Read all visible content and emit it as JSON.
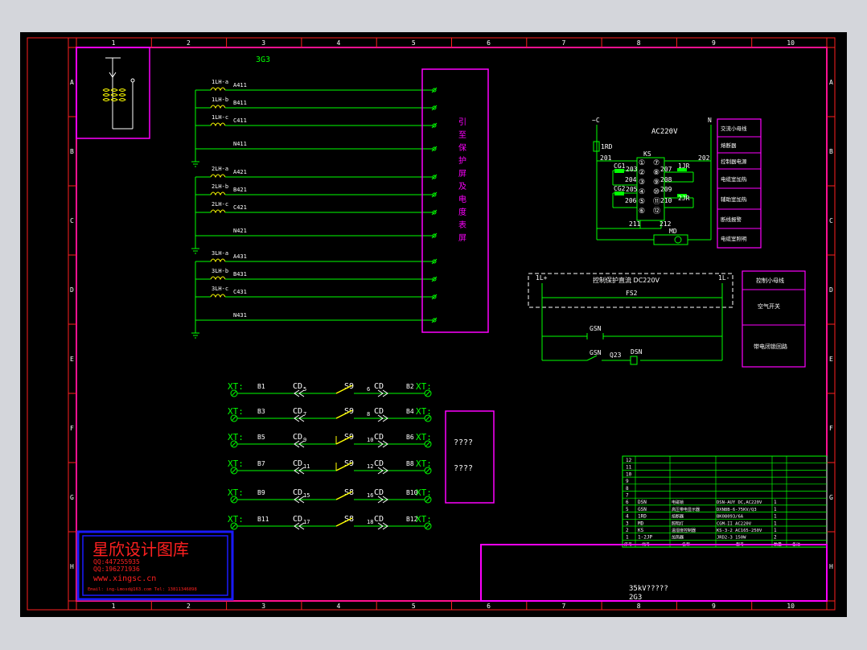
{
  "colors": {
    "background": "#000000",
    "outer_frame": "#ff2020",
    "inner_frame": "#ff00ff",
    "wire": "#00ff00",
    "text": "#ffffff",
    "label": "#00ff00",
    "yellow": "#ffff00",
    "logo_red": "#ff2020",
    "logo_blue": "#1a1aff",
    "dashed": "#ffffff"
  },
  "grid": {
    "columns": [
      "1",
      "2",
      "3",
      "4",
      "5",
      "6",
      "7",
      "8",
      "9",
      "10"
    ],
    "rows": [
      "A",
      "B",
      "C",
      "D",
      "E",
      "F",
      "G",
      "H"
    ]
  },
  "drawing_id": "3G3",
  "ct_labels": {
    "g1": [
      "1LH-a",
      "1LH-b",
      "1LH-c"
    ],
    "g2": [
      "2LH-a",
      "2LH-b",
      "2LH-c"
    ],
    "g3": [
      "3LH-a",
      "3LH-b",
      "3LH-c"
    ]
  },
  "wire_labels": {
    "g1": [
      "A411",
      "B411",
      "C411",
      "N411"
    ],
    "g2": [
      "A421",
      "B421",
      "C421",
      "N421"
    ],
    "g3": [
      "A431",
      "B431",
      "C431",
      "N431"
    ]
  },
  "protection_box_text": [
    "引",
    "至",
    "保",
    "护",
    "屏",
    "及",
    "电",
    "度",
    "表",
    "屏"
  ],
  "ac_circuit": {
    "ac_voltage": "AC220V",
    "left_bus": "~C",
    "right_bus": "N",
    "fuse": "1RD",
    "relay": "KS",
    "lamp": "MD",
    "node_labels": [
      "201",
      "202",
      "203",
      "204",
      "205",
      "206",
      "207",
      "208",
      "209",
      "210",
      "211",
      "212"
    ],
    "cg_labels": [
      "CG1",
      "CG2"
    ],
    "jr_labels": [
      "1JR",
      "2JR"
    ],
    "terminals": [
      "①",
      "②",
      "③",
      "④",
      "⑤",
      "⑥",
      "⑦",
      "⑧",
      "⑨",
      "⑩",
      "⑪",
      "⑫"
    ]
  },
  "ac_side_labels": [
    "交流小母线",
    "熔断器",
    "控制器电源",
    "电缆室加热",
    "辅助室加热",
    "断线报警",
    "电缆室照明"
  ],
  "dc_circuit": {
    "plus_bus": "1L+",
    "minus_bus": "1L-",
    "title": "控制保护直流 DC220V",
    "fuse": "FS2",
    "gsn_labels": [
      "GSN",
      "GSN",
      "DSN"
    ],
    "q_label": "Q23"
  },
  "dc_side_labels": [
    "控制小母线",
    "空气开关",
    "带电闭锁回路"
  ],
  "bottom_rows": [
    {
      "xt": "XT:",
      "b": "B1",
      "cd": "CD",
      "cd_sub": "5",
      "s": "S9",
      "n": "6",
      "cd2": "CD",
      "b2": "B2"
    },
    {
      "xt": "XT:",
      "b": "B3",
      "cd": "CD",
      "cd_sub": "7",
      "s": "S9",
      "n": "8",
      "cd2": "CD",
      "b2": "B4"
    },
    {
      "xt": "XT:",
      "b": "B5",
      "cd": "CD",
      "cd_sub": "9",
      "s": "S9",
      "n": "10",
      "cd2": "CD",
      "b2": "B6"
    },
    {
      "xt": "XT:",
      "b": "B7",
      "cd": "CD",
      "cd_sub": "11",
      "s": "S9",
      "n": "12",
      "cd2": "CD",
      "b2": "B8"
    },
    {
      "xt": "XT:",
      "b": "B9",
      "cd": "CD",
      "cd_sub": "15",
      "s": "S8",
      "n": "16",
      "cd2": "CD",
      "b2": "B10"
    },
    {
      "xt": "XT:",
      "b": "B11",
      "cd": "CD",
      "cd_sub": "17",
      "s": "S8",
      "n": "18",
      "cd2": "CD",
      "b2": "B12"
    }
  ],
  "unknown_box": [
    "????",
    "????"
  ],
  "parts_table": {
    "rows": [
      {
        "n": "12",
        "code": "",
        "name": "",
        "model": "",
        "qty": ""
      },
      {
        "n": "11",
        "code": "",
        "name": "",
        "model": "",
        "qty": ""
      },
      {
        "n": "10",
        "code": "",
        "name": "",
        "model": "",
        "qty": ""
      },
      {
        "n": "9",
        "code": "",
        "name": "",
        "model": "",
        "qty": ""
      },
      {
        "n": "8",
        "code": "",
        "name": "",
        "model": "",
        "qty": ""
      },
      {
        "n": "7",
        "code": "",
        "name": "",
        "model": "",
        "qty": ""
      },
      {
        "n": "6",
        "code": "DSN",
        "name": "电磁锁",
        "model": "DSN-AUY DC,AC220V",
        "qty": "1"
      },
      {
        "n": "5",
        "code": "GSN",
        "name": "高压带电显示器",
        "model": "DXN8B-6-75KV/Q3",
        "qty": "1"
      },
      {
        "n": "4",
        "code": "1RD",
        "name": "熔断器",
        "model": "BK08093/6A",
        "qty": "1"
      },
      {
        "n": "3",
        "code": "MD",
        "name": "照明灯",
        "model": "CGM-II AC220V",
        "qty": "1"
      },
      {
        "n": "2",
        "code": "KS",
        "name": "温湿度控制器",
        "model": "KS-3-2 AC165-250V",
        "qty": "1"
      },
      {
        "n": "1",
        "code": "1-2JP",
        "name": "加热器",
        "model": "JRD2-3 150W",
        "qty": "2"
      }
    ],
    "header": {
      "n": "序号",
      "code": "代号",
      "name": "名称",
      "model": "型号",
      "qty": "数量",
      "remark": "备注"
    }
  },
  "title_block": {
    "title": "35kV?????",
    "drawing": "2G3"
  },
  "logo": {
    "name": "星欣设计图库",
    "qq1": "QQ:447255935",
    "qq2": "QQ:196271936",
    "url": "www.xingsc.cn",
    "contact": "Email: ing-Lmosd@163.com  Tel: 13811346898"
  }
}
